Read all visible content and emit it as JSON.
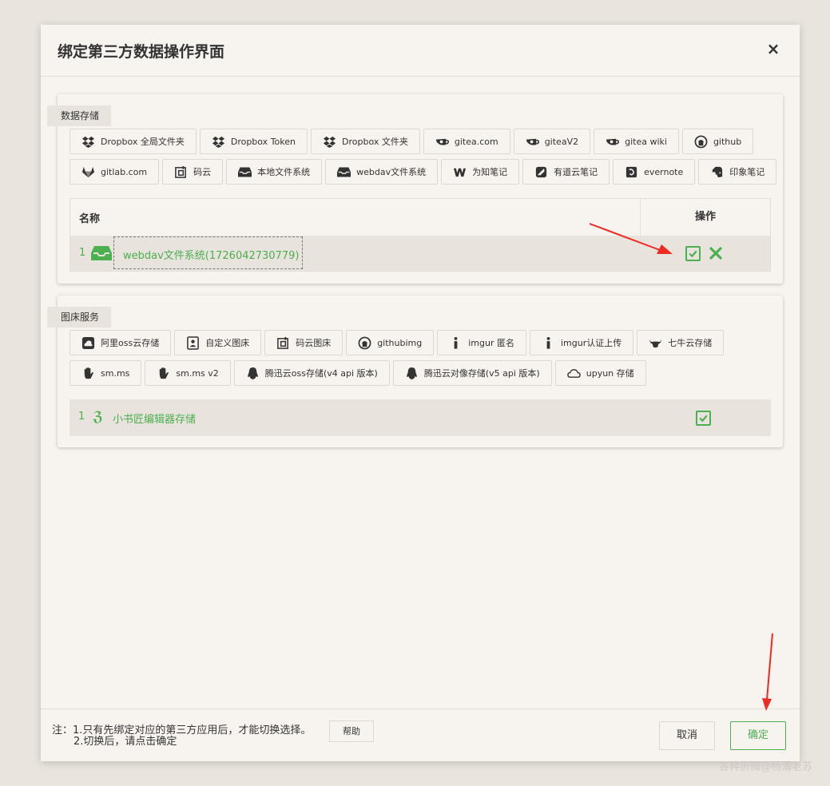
{
  "dialog": {
    "title": "绑定第三方数据操作界面",
    "close_symbol": "×"
  },
  "storage": {
    "section_label": "数据存储",
    "buttons_row1": [
      {
        "label": "Dropbox 全局文件夹",
        "icon": "dropbox-icon"
      },
      {
        "label": "Dropbox Token",
        "icon": "dropbox-icon"
      },
      {
        "label": "Dropbox 文件夹",
        "icon": "dropbox-icon"
      },
      {
        "label": "gitea.com",
        "icon": "gitea-icon"
      },
      {
        "label": "giteaV2",
        "icon": "gitea-icon"
      },
      {
        "label": "gitea wiki",
        "icon": "gitea-icon"
      },
      {
        "label": "github",
        "icon": "github-icon"
      }
    ],
    "buttons_row2": [
      {
        "label": "gitlab.com",
        "icon": "gitlab-icon"
      },
      {
        "label": "码云",
        "icon": "gitee-icon"
      },
      {
        "label": "本地文件系统",
        "icon": "inbox-icon"
      },
      {
        "label": "webdav文件系统",
        "icon": "inbox-icon"
      },
      {
        "label": "为知笔记",
        "icon": "wiz-icon"
      },
      {
        "label": "有道云笔记",
        "icon": "youdao-icon"
      },
      {
        "label": "evernote",
        "icon": "evernote-icon"
      },
      {
        "label": "印象笔记",
        "icon": "elephant-icon"
      }
    ],
    "table": {
      "col_name": "名称",
      "col_action": "操作",
      "rows": [
        {
          "index": "1",
          "label": "webdav文件系统(1726042730779)",
          "icon": "inbox-icon"
        }
      ]
    }
  },
  "image_host": {
    "section_label": "图床服务",
    "buttons_row1": [
      {
        "label": "阿里oss云存储",
        "icon": "aliyun-cloud-icon"
      },
      {
        "label": "自定义图床",
        "icon": "contact-card-icon"
      },
      {
        "label": "码云图床",
        "icon": "gitee-icon"
      },
      {
        "label": "githubimg",
        "icon": "github-icon"
      },
      {
        "label": "imgur 匿名",
        "icon": "info-icon"
      },
      {
        "label": "imgur认证上传",
        "icon": "info-icon"
      },
      {
        "label": "七牛云存储",
        "icon": "bull-icon"
      }
    ],
    "buttons_row2": [
      {
        "label": "sm.ms",
        "icon": "hand-icon"
      },
      {
        "label": "sm.ms v2",
        "icon": "hand-icon"
      },
      {
        "label": "腾迅云oss存储(v4 api 版本)",
        "icon": "qq-penguin-icon"
      },
      {
        "label": "腾迅云对像存储(v5 api 版本)",
        "icon": "qq-penguin-icon"
      },
      {
        "label": "upyun 存储",
        "icon": "cloud-outline-icon"
      }
    ],
    "selected": {
      "index": "1",
      "label": "小书匠编辑器存储",
      "icon_glyph": "ℨ"
    }
  },
  "footer": {
    "note_line1": "注：1.只有先绑定对应的第三方应用后，才能切换选择。",
    "note_line2": "2.切换后，请点击确定",
    "help_label": "帮助",
    "cancel_label": "取消",
    "ok_label": "确定"
  },
  "watermark": "各种折腾@杨浦老苏",
  "colors": {
    "accent": "#4caf50",
    "annotation_arrow": "#ee2a24"
  }
}
